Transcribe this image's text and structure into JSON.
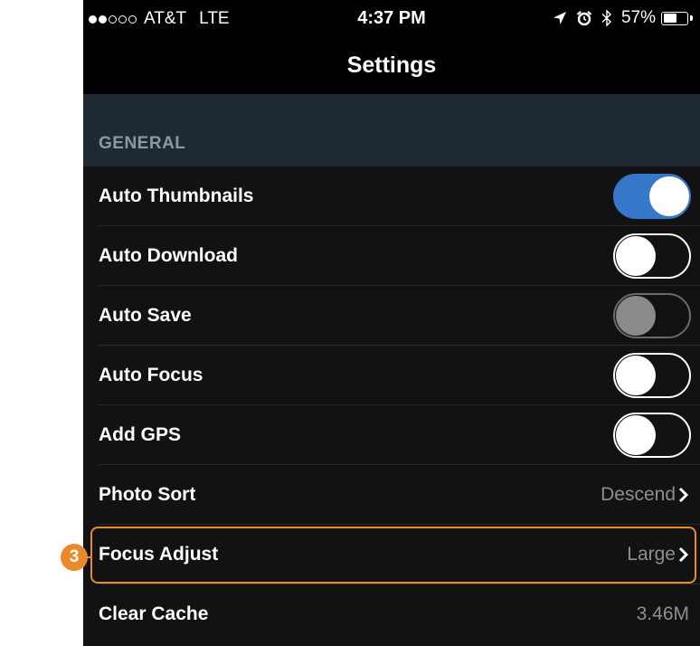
{
  "status_bar": {
    "signal_filled": 2,
    "signal_total": 5,
    "carrier": "AT&T",
    "network": "LTE",
    "time": "4:37 PM",
    "icons": [
      "location-arrow-icon",
      "alarm-clock-icon",
      "bluetooth-icon"
    ],
    "battery_percent_label": "57%",
    "battery_level": 0.57
  },
  "nav": {
    "title": "Settings"
  },
  "general": {
    "header": "GENERAL",
    "rows": [
      {
        "label": "Auto Thumbnails",
        "type": "toggle",
        "state": "on"
      },
      {
        "label": "Auto Download",
        "type": "toggle",
        "state": "off"
      },
      {
        "label": "Auto Save",
        "type": "toggle",
        "state": "disabled"
      },
      {
        "label": "Auto Focus",
        "type": "toggle",
        "state": "off"
      },
      {
        "label": "Add GPS",
        "type": "toggle",
        "state": "off"
      },
      {
        "label": "Photo Sort",
        "type": "value",
        "value": "Descend",
        "chevron": true
      },
      {
        "label": "Focus Adjust",
        "type": "value",
        "value": "Large",
        "chevron": true
      },
      {
        "label": "Clear Cache",
        "type": "value",
        "value": "3.46M",
        "chevron": false
      }
    ]
  },
  "annotation": {
    "callout_number": "3",
    "color": "#e98a2d"
  },
  "colors": {
    "toggle_on": "#3577c8",
    "background": "#000000",
    "section_header_bg": "#1f2933"
  }
}
